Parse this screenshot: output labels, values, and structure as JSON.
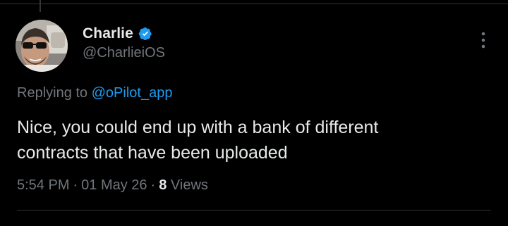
{
  "tweet": {
    "author": {
      "display_name": "Charlie",
      "handle": "@CharlieiOS",
      "verified": true
    },
    "replying_to": {
      "prefix": "Replying to ",
      "mention": "@oPilot_app"
    },
    "text_lines": [
      "Nice, you could end up with a bank of different",
      "contracts that have been uploaded"
    ],
    "meta": {
      "time": "5:54 PM",
      "separator": "·",
      "date": "01 May 26",
      "views_count": "8",
      "views_label": "Views"
    }
  },
  "icons": {
    "verified": "verified-badge-icon",
    "more": "more-vertical-icon"
  },
  "colors": {
    "background": "#000000",
    "primary_text": "#e7e9ea",
    "secondary_text": "#71767b",
    "accent": "#1d9bf0",
    "divider": "#2f3336"
  }
}
